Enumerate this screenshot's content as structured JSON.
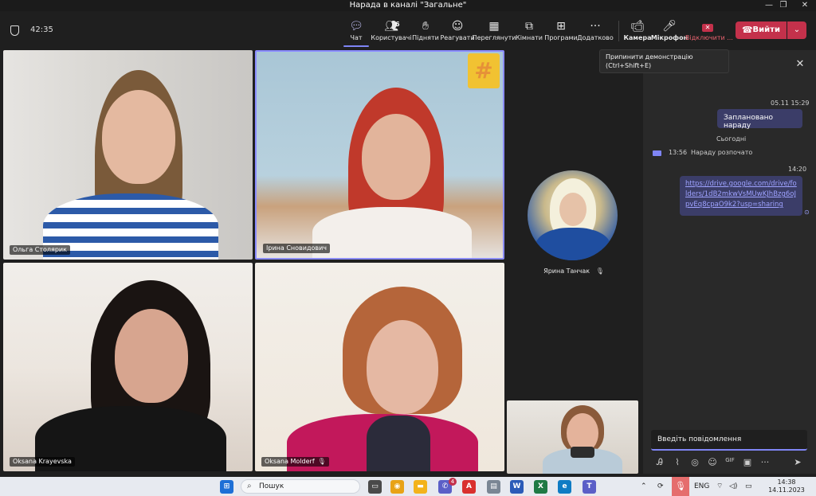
{
  "window": {
    "title": "Нарада в каналі \"Загальне\"",
    "minimize": "—",
    "maximize": "❐",
    "close": "✕"
  },
  "toolbar": {
    "timer": "42:35",
    "chat": "Чат",
    "people": "Користувачі",
    "people_count": "6",
    "raise": "Підняти",
    "react": "Реагувати",
    "view": "Переглянути",
    "rooms": "Кімнати",
    "apps": "Програми",
    "more": "Додатково",
    "camera": "Камера",
    "mic": "Мікрофон",
    "share": "Відключити ...",
    "leave": "Вийти"
  },
  "tooltip": {
    "line1": "Припинити демонстрацію",
    "line2": "(Ctrl+Shift+E)"
  },
  "participants": {
    "olga": "Ольга Столярик",
    "irina": "Ірина Сновидович",
    "oksana_k": "Oksana Krayevska",
    "oksana_m": "Oksana Molderf",
    "yaryna": "Ярина Танчак"
  },
  "chat": {
    "msg1_time": "05.11 15:29",
    "msg1_text": "Заплановано нараду",
    "today": "Сьогодні",
    "sys_time": "13:56",
    "sys_text": "Нараду розпочато",
    "msg2_time": "14:20",
    "msg2_link": "https://drive.google.com/drive/folders/1dB2mkwVsMUwKJhBzg6oJpvEq8cpaO9k2?usp=sharing",
    "input_placeholder": "Введіть повідомлення"
  },
  "taskbar": {
    "search": "Пошук",
    "lang": "ENG",
    "time": "14:38",
    "date": "14.11.2023",
    "teams_badge": "4"
  }
}
